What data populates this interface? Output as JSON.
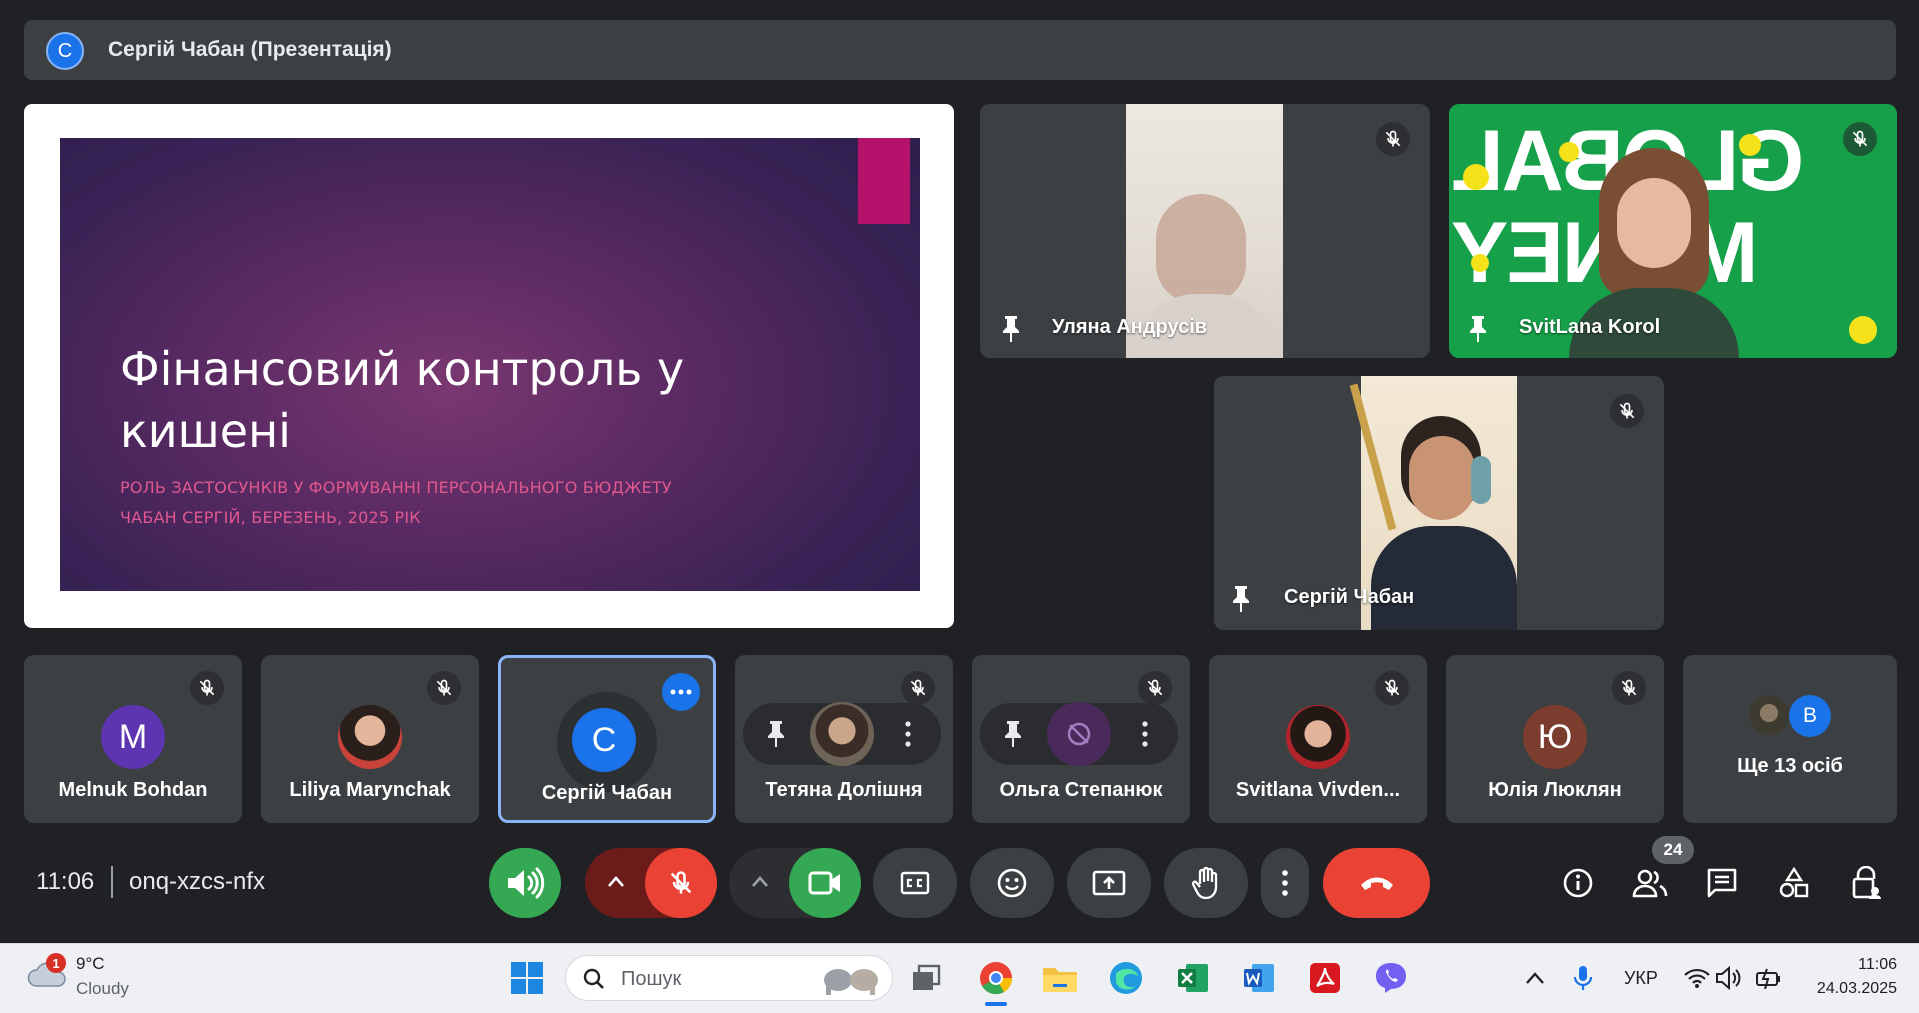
{
  "presenter_bar": {
    "avatar_letter": "С",
    "title": "Сергій Чабан (Презентація)"
  },
  "slide": {
    "title": "Фінансовий контроль у кишені",
    "subtitle1": "РОЛЬ ЗАСТОСУНКІВ У ФОРМУВАННІ ПЕРСОНАЛЬНОГО БЮДЖЕТУ",
    "subtitle2": "ЧАБАН СЕРГІЙ, БЕРЕЗЕНЬ, 2025 РІК"
  },
  "video_tiles": [
    {
      "name": "Уляна Андрусів"
    },
    {
      "name": "SvitLana Korol",
      "background_text": "GLOBAL MONEY WEEK"
    },
    {
      "name": "Сергій Чабан"
    }
  ],
  "participants": [
    {
      "name": "Melnuk Bohdan",
      "avatar": "M",
      "color": "#5e35b1"
    },
    {
      "name": "Liliya Marynchak",
      "avatar": "",
      "color": "#c98b6b"
    },
    {
      "name": "Сергій Чабан",
      "avatar": "С",
      "color": "#1a73e8"
    },
    {
      "name": "Тетяна Долішня",
      "avatar": "",
      "color": "#8d7b6a"
    },
    {
      "name": "Ольга Степанюк",
      "avatar": "",
      "color": "#4a2a5a"
    },
    {
      "name": "Svitlana Vivden...",
      "avatar": "",
      "color": "#9b2c2c"
    },
    {
      "name": "Юлія Люклян",
      "avatar": "Ю",
      "color": "#7a3d2e"
    },
    {
      "name": "Ще 13 осіб",
      "avatar": "B",
      "color": "#1a73e8"
    }
  ],
  "meeting": {
    "time": "11:06",
    "code": "onq-xzcs-nfx",
    "people_count": "24"
  },
  "taskbar": {
    "temp": "9°C",
    "weather": "Cloudy",
    "weather_badge": "1",
    "search_placeholder": "Пошук",
    "lang": "УКР",
    "clock_time": "11:06",
    "clock_date": "24.03.2025"
  },
  "colors": {
    "meet_bg": "#202124",
    "tile": "#3c4043",
    "green": "#34a853",
    "red": "#ea4335",
    "blue": "#1a73e8"
  }
}
